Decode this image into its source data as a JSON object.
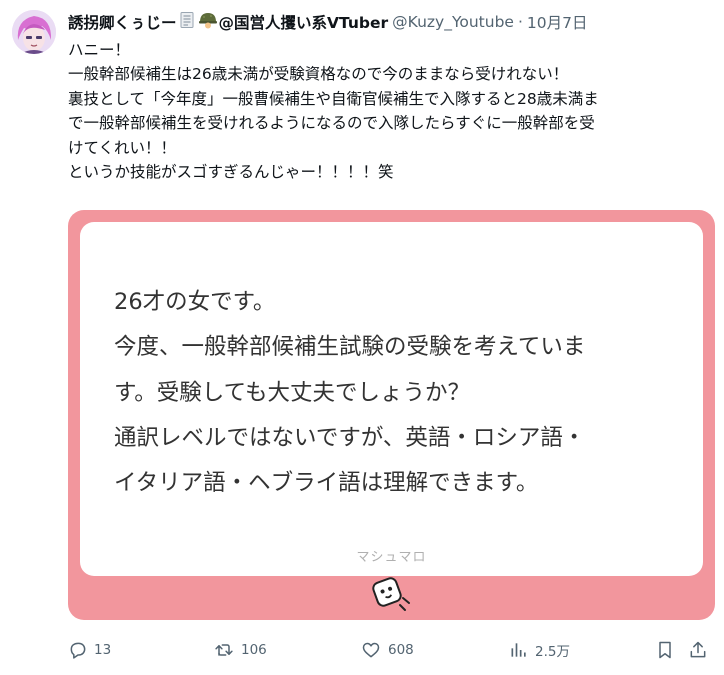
{
  "tweet": {
    "display_name": "誘拐卿くぅじー",
    "name_suffix": "@国営人攫い系VTuber",
    "handle": "@Kuzy_Youtube",
    "separator": "·",
    "date": "10月7日",
    "header_icons": [
      "memo-icon",
      "military-helmet-icon"
    ],
    "text_lines": [
      "ハニー！",
      "一般幹部候補生は26歳未満が受験資格なので今のままなら受けれない！",
      "裏技として「今年度」一般曹候補生や自衛官候補生で入隊すると28歳未満ま",
      "で一般幹部候補生を受けれるようになるので入隊したらすぐに一般幹部を受",
      "けてくれい！！",
      "というか技能がスゴすぎるんじゃー！！！！笑"
    ]
  },
  "card": {
    "question_lines": [
      "26才の女です。",
      "今度、一般幹部候補生試験の受験を考えていま",
      "す。受験しても大丈夫でしょうか？",
      "通訳レベルではないですが、英語・ロシア語・",
      "イタリア語・ヘブライ語は理解できます。"
    ],
    "brand": "マシュマロ",
    "colors": {
      "frame": "#f2969d",
      "inner": "#ffffff",
      "text": "#333333"
    }
  },
  "actions": {
    "replies": "13",
    "reposts": "106",
    "likes": "608",
    "views": "2.5万"
  },
  "colors": {
    "text": "#0f1419",
    "secondary": "#536471"
  }
}
